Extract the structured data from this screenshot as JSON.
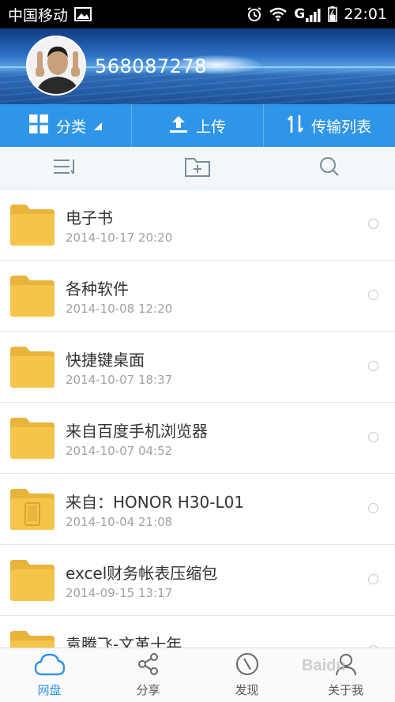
{
  "status_bar": {
    "carrier": "中国移动",
    "network": "G",
    "time": "22:01"
  },
  "profile": {
    "username": "568087278"
  },
  "actions": [
    {
      "label": "分类",
      "icon": "grid-icon"
    },
    {
      "label": "上传",
      "icon": "upload-icon"
    },
    {
      "label": "传输列表",
      "icon": "transfer-icon"
    }
  ],
  "toolbar": {
    "icons": [
      "sort-list-icon",
      "new-folder-icon",
      "search-icon"
    ]
  },
  "files": [
    {
      "name": "电子书",
      "date": "2014-10-17  20:20"
    },
    {
      "name": "各种软件",
      "date": "2014-10-08  12:20"
    },
    {
      "name": "快捷键桌面",
      "date": "2014-10-07  18:37"
    },
    {
      "name": "来自百度手机浏览器",
      "date": "2014-10-07  04:52"
    },
    {
      "name": "来自：HONOR H30-L01",
      "date": "2014-10-04  21:08"
    },
    {
      "name": "excel财务帐表压缩包",
      "date": "2014-09-15  13:17"
    },
    {
      "name": "袁腾飞-文革十年",
      "date": ""
    }
  ],
  "bottom_nav": [
    {
      "label": "网盘",
      "icon": "cloud-icon",
      "active": true
    },
    {
      "label": "分享",
      "icon": "share-icon",
      "active": false
    },
    {
      "label": "发现",
      "icon": "compass-icon",
      "active": false
    },
    {
      "label": "关于我",
      "icon": "user-icon",
      "active": false
    }
  ],
  "watermark": "Baidu",
  "colors": {
    "accent": "#2f95e8",
    "folder": "#f5c44a",
    "folder_tab": "#e9b43c"
  }
}
